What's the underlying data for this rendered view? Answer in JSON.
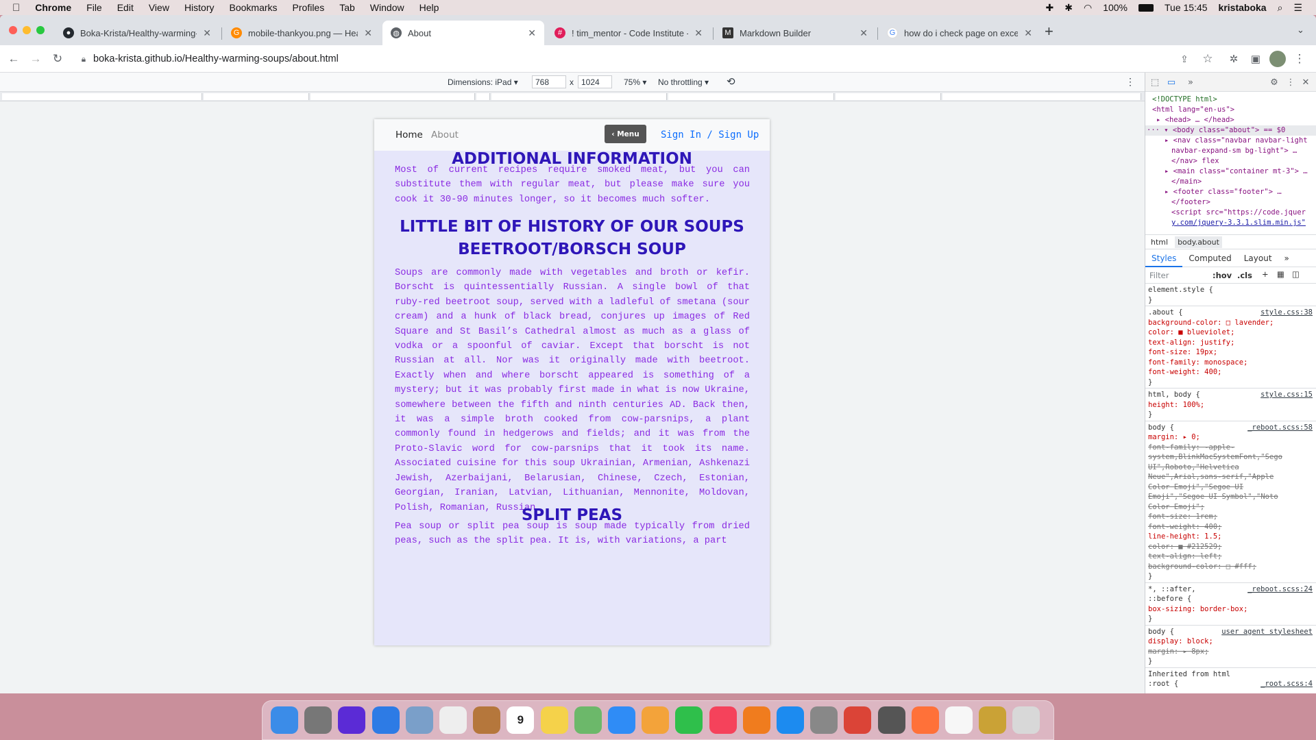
{
  "menubar": {
    "apple": "",
    "app": "Chrome",
    "items": [
      "File",
      "Edit",
      "View",
      "History",
      "Bookmarks",
      "Profiles",
      "Tab",
      "Window",
      "Help"
    ],
    "battery": "100%",
    "clock": "Tue 15:45",
    "user": "kristaboka"
  },
  "tabs": [
    {
      "title": "Boka-Krista/Healthy-warming-",
      "icon": "github-icon"
    },
    {
      "title": "mobile-thankyou.png — Healt",
      "icon": "gitpod-icon"
    },
    {
      "title": "About",
      "icon": "globe-icon"
    },
    {
      "title": "! tim_mentor - Code Institute -",
      "icon": "slack-icon"
    },
    {
      "title": "Markdown Builder",
      "icon": "markdown-icon"
    },
    {
      "title": "how do i check page on excel",
      "icon": "google-icon"
    }
  ],
  "new_tab": "+",
  "address": {
    "url": "boka-krista.github.io/Healthy-warming-soups/about.html"
  },
  "device_toolbar": {
    "dimensions_label": "Dimensions: iPad ▾",
    "width": "768",
    "x": "x",
    "height": "1024",
    "zoom": "75% ▾",
    "throttling": "No throttling ▾"
  },
  "page": {
    "nav_home": "Home",
    "nav_about": "About",
    "menu_button": "‹ Menu",
    "sign_in": "Sign In / Sign Up",
    "h1": "ADDITIONAL INFORMATION",
    "p1": "Most of current recipes require smoked meat, but you can substitute them with regular meat, but please make sure you cook it 30-90 minutes longer, so it becomes much softer.",
    "h2_line1": "LITTLE BIT OF HISTORY OF OUR SOUPS",
    "h2_line2": "BEETROOT/BORSCH SOUP",
    "p2": "Soups are commonly made with vegetables and broth or kefir. Borscht is quintessentially Russian. A single bowl of that ruby-red beetroot soup, served with a ladleful of smetana (sour cream) and a hunk of black bread, conjures up images of Red Square and St Basil’s Cathedral almost as much as a glass of vodka or a spoonful of caviar. Except that borscht is not Russian at all. Nor was it originally made with beetroot. Exactly when and where borscht appeared is something of a mystery; but it was probably first made in what is now Ukraine, somewhere between the fifth and ninth centuries AD. Back then, it was a simple broth cooked from cow-parsnips, a plant commonly found in hedgerows and fields; and it was from the Proto-Slavic word for cow-parsnips that it took its name. Associated cuisine for this soup Ukrainian, Armenian, Ashkenazi Jewish, Azerbaijani, Belarusian, Chinese, Czech, Estonian, Georgian, Iranian, Latvian, Lithuanian, Mennonite, Moldovan, Polish, Romanian, Russian.",
    "h3": "SPLIT PEAS",
    "p3": "Pea soup or split pea soup is soup made typically from dried peas, such as the split pea. It is, with variations, a part"
  },
  "devtools": {
    "dom_lines": [
      {
        "h": "<!DOCTYPE html>",
        "c": "cm"
      },
      {
        "h": "<html lang=\"en-us\">"
      },
      {
        "h": "▸ <head> … </head>"
      },
      {
        "h": "··· ▾ <body class=\"about\"> == $0"
      },
      {
        "h": "▸ <nav class=\"navbar navbar-light"
      },
      {
        "h": "navbar-expand-sm bg-light\"> …"
      },
      {
        "h": "</nav> flex"
      },
      {
        "h": "▸ <main class=\"container mt-3\"> …"
      },
      {
        "h": "</main>"
      },
      {
        "h": "▸ <footer class=\"footer\"> …"
      },
      {
        "h": "</footer>"
      },
      {
        "h": "<script src=\"https://code.jquer"
      },
      {
        "h": "y.com/jquery-3.3.1.slim.min.js\""
      }
    ],
    "crumb1": "html",
    "crumb2": "body.about",
    "style_tabs": [
      "Styles",
      "Computed",
      "Layout",
      "»"
    ],
    "filter": "Filter",
    "hov": ":hov",
    "cls": ".cls",
    "rules": [
      {
        "t": "element.style {"
      },
      {
        "t": "}"
      },
      {
        "t": ".about {",
        "src": "style.css:38"
      },
      {
        "t": "  background-color: □ lavender;"
      },
      {
        "t": "  color: ■ blueviolet;"
      },
      {
        "t": "  text-align: justify;"
      },
      {
        "t": "  font-size: 19px;"
      },
      {
        "t": "  font-family: monospace;"
      },
      {
        "t": "  font-weight: 400;"
      },
      {
        "t": "}"
      },
      {
        "t": "html, body {",
        "src": "style.css:15"
      },
      {
        "t": "  height: 100%;"
      },
      {
        "t": "}"
      },
      {
        "t": "body {",
        "src": "_reboot.scss:58"
      },
      {
        "t": "  margin: ▸ 0;"
      },
      {
        "t": "  font-family: -apple-",
        "s": true
      },
      {
        "t": "    system,BlinkMacSystemFont,\"Sego",
        "s": true
      },
      {
        "t": "    UI\",Roboto,\"Helvetica",
        "s": true
      },
      {
        "t": "    Neue\",Arial,sans-serif,\"Apple",
        "s": true
      },
      {
        "t": "    Color Emoji\",\"Segoe UI",
        "s": true
      },
      {
        "t": "    Emoji\",\"Segoe UI Symbol\",\"Noto",
        "s": true
      },
      {
        "t": "    Color Emoji\";",
        "s": true
      },
      {
        "t": "  font-size: 1rem;",
        "s": true
      },
      {
        "t": "  font-weight: 400;",
        "s": true
      },
      {
        "t": "  line-height: 1.5;"
      },
      {
        "t": "  color: ■ #212529;",
        "s": true
      },
      {
        "t": "  text-align: left;",
        "s": true
      },
      {
        "t": "  background-color: □ #fff;",
        "s": true
      },
      {
        "t": "}"
      },
      {
        "t": "*, ::after,",
        "src": "_reboot.scss:24"
      },
      {
        "t": "::before {"
      },
      {
        "t": "  box-sizing: border-box;"
      },
      {
        "t": "}"
      },
      {
        "t": "body {",
        "src": "user agent stylesheet"
      },
      {
        "t": "  display: block;"
      },
      {
        "t": "  margin: ▸ 8px;",
        "s": true
      },
      {
        "t": "}"
      },
      {
        "t": "Inherited from html"
      },
      {
        "t": ":root {",
        "src": "_root.scss:4"
      }
    ]
  },
  "dock": [
    {
      "n": "finder-icon",
      "c": "#3b8ce8"
    },
    {
      "n": "launchpad-icon",
      "c": "#777"
    },
    {
      "n": "siri-icon",
      "c": "#5b2bd6"
    },
    {
      "n": "safari-icon",
      "c": "#2d7be5"
    },
    {
      "n": "preview-icon",
      "c": "#7a9fc9"
    },
    {
      "n": "reminders-icon",
      "c": "#eee"
    },
    {
      "n": "notebook-icon",
      "c": "#b5773c"
    },
    {
      "n": "calendar-icon",
      "c": "#fff",
      "label": "9"
    },
    {
      "n": "notes-icon",
      "c": "#f5d24a"
    },
    {
      "n": "maps-icon",
      "c": "#6cb86a"
    },
    {
      "n": "messages-icon",
      "c": "#2f8cf6"
    },
    {
      "n": "photos-icon",
      "c": "#f3a33a"
    },
    {
      "n": "facetime-icon",
      "c": "#2fbf4b"
    },
    {
      "n": "music-icon",
      "c": "#f5425b"
    },
    {
      "n": "books-icon",
      "c": "#f07c1e"
    },
    {
      "n": "app-store-icon",
      "c": "#1c8bf0"
    },
    {
      "n": "settings-icon",
      "c": "#888"
    },
    {
      "n": "chrome-icon",
      "c": "#db4437"
    },
    {
      "n": "xcode-icon",
      "c": "#555"
    },
    {
      "n": "firefox-icon",
      "c": "#ff7139"
    },
    {
      "n": "minimized-window-icon",
      "c": "#f7f7f7"
    },
    {
      "n": "minimized-window-icon",
      "c": "#caa236"
    },
    {
      "n": "trash-icon",
      "c": "#d8d8d8"
    }
  ]
}
